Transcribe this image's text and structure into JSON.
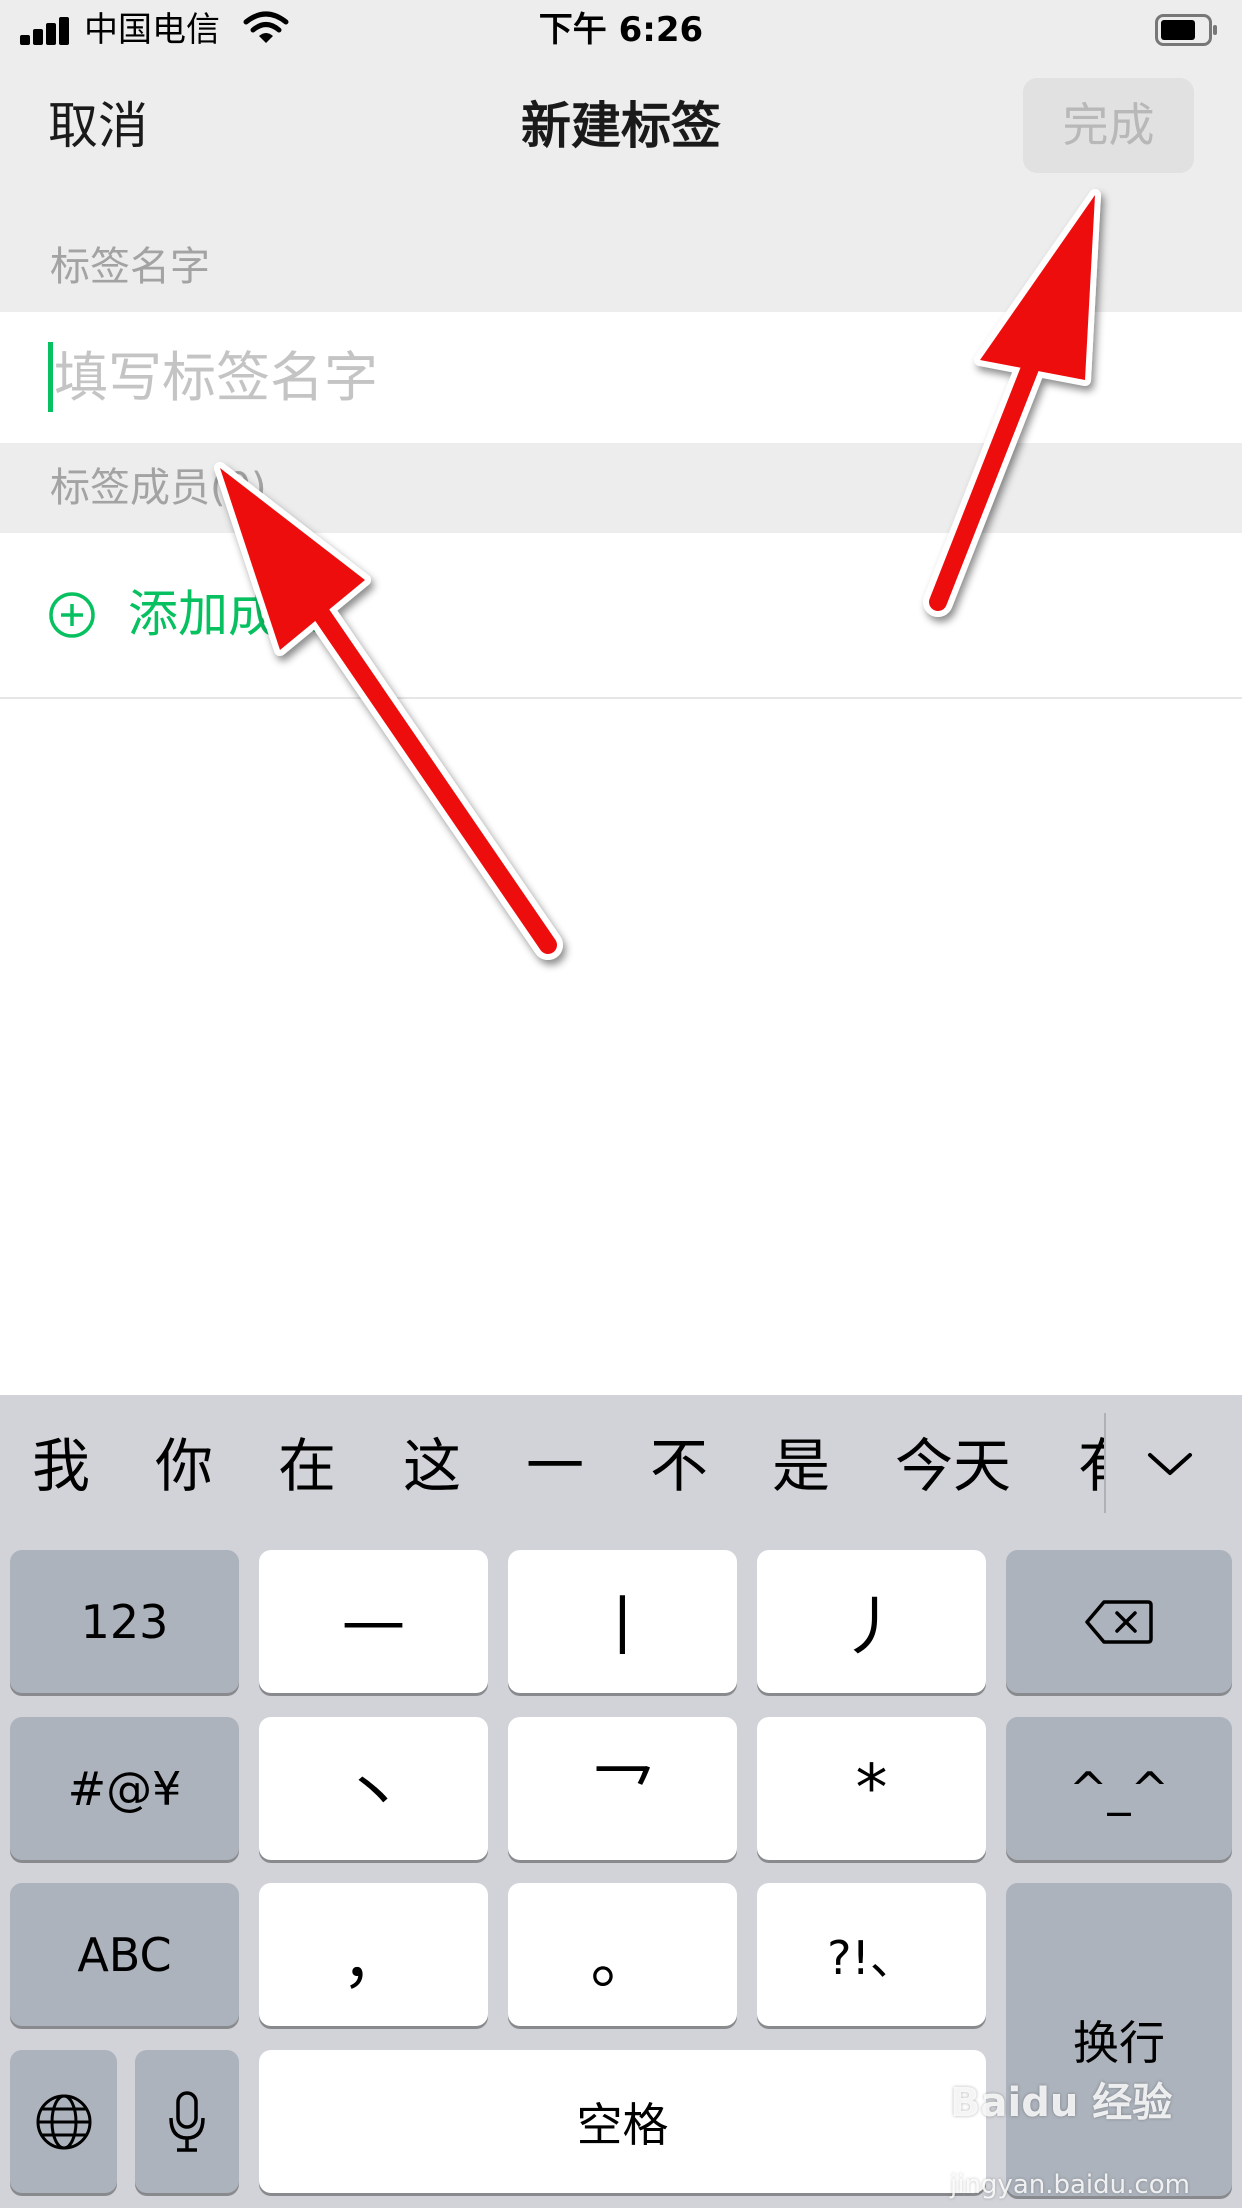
{
  "status_bar": {
    "carrier": "中国电信",
    "time": "下午 6:26"
  },
  "nav": {
    "cancel_label": "取消",
    "title": "新建标签",
    "done_label": "完成"
  },
  "form": {
    "name_section_label": "标签名字",
    "name_placeholder": "填写标签名字",
    "name_value": "",
    "members_section_label": "标签成员(0)",
    "add_member_label": "添加成员"
  },
  "keyboard": {
    "candidates": [
      "我",
      "你",
      "在",
      "这",
      "一",
      "不",
      "是",
      "今天",
      "有"
    ],
    "row1": {
      "num": "123",
      "k1": "—",
      "k2": "丨",
      "k3": "丿"
    },
    "row2": {
      "sym": "#@¥",
      "k1": "丶",
      "k2": "乛",
      "k3": "*",
      "emoji": "^_^"
    },
    "row3": {
      "abc": "ABC",
      "k1": "，",
      "k2": "。",
      "k3": "?!、",
      "return": "换行"
    },
    "space": "空格"
  },
  "watermark": {
    "logo": "Baidu 经验",
    "url": "jingyan.baidu.com"
  },
  "colors": {
    "accent_green": "#07c160",
    "annotation_red": "#ee1111"
  },
  "icons": [
    "signal-icon",
    "wifi-icon",
    "battery-icon",
    "add-circle-icon",
    "chevron-down-icon",
    "backspace-icon",
    "globe-icon",
    "microphone-icon"
  ]
}
